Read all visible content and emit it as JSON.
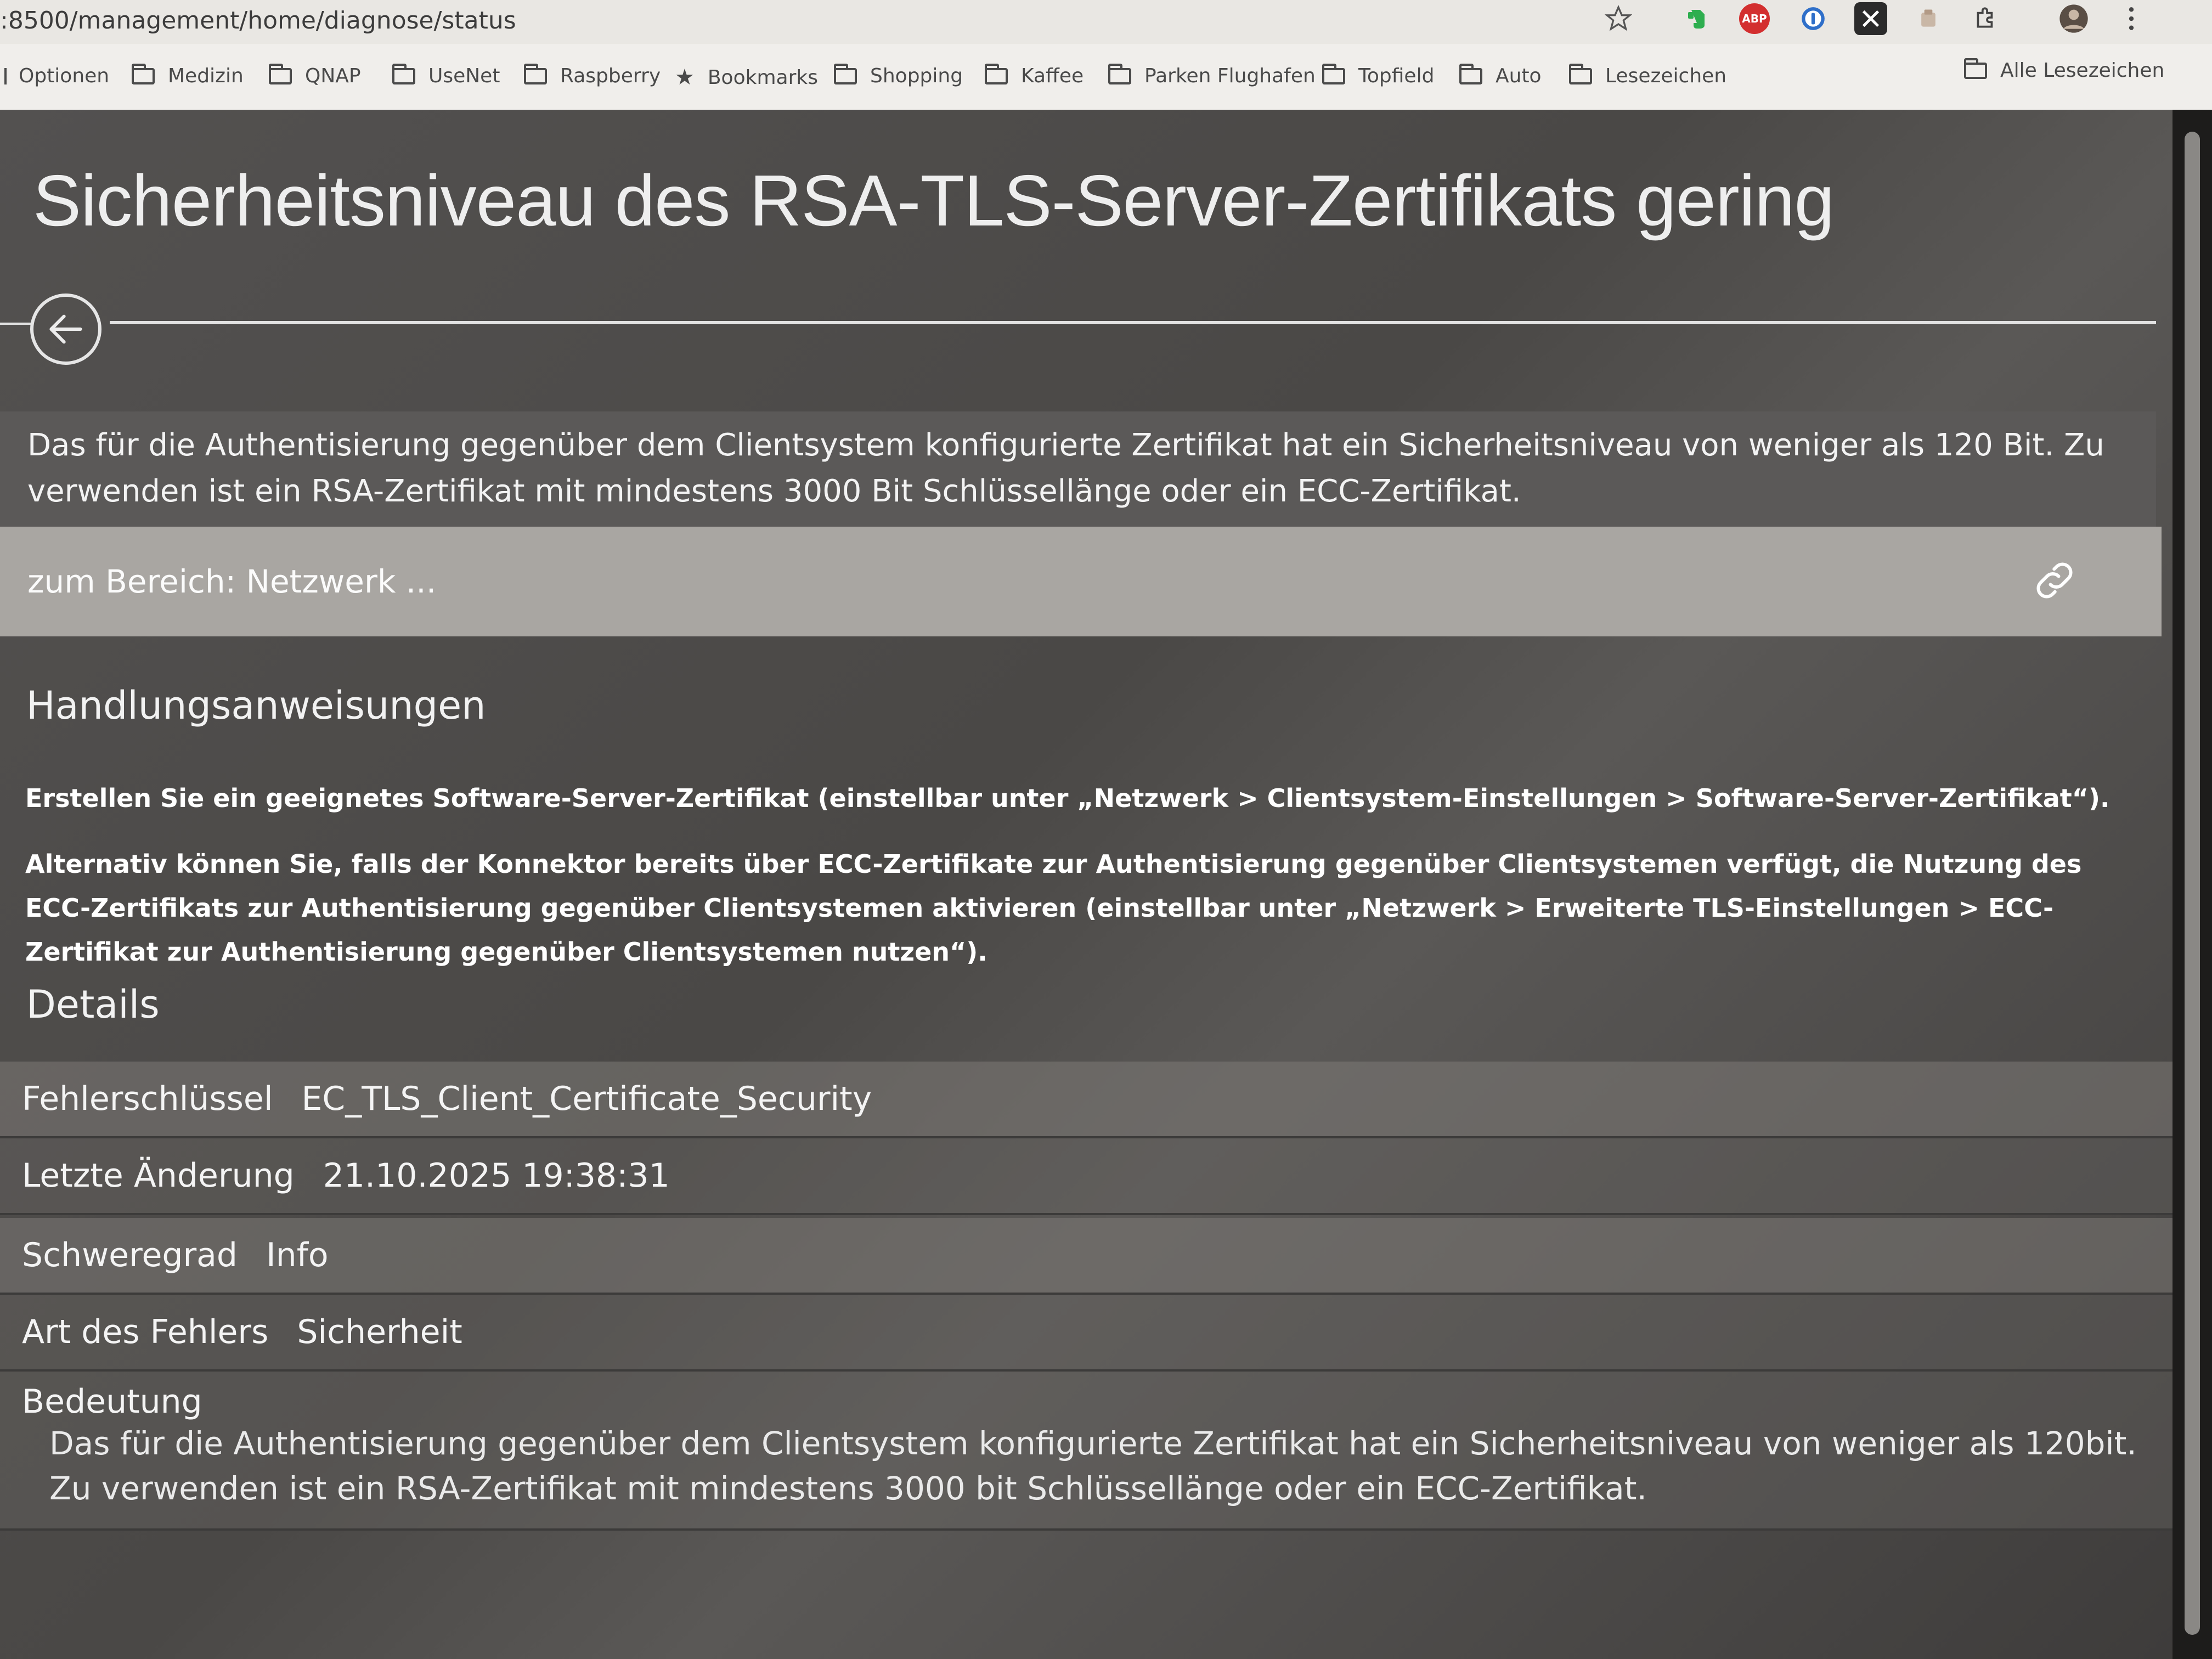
{
  "browser": {
    "url": ":8500/management/home/diagnose/status",
    "bookmarks": [
      {
        "label": "Optionen",
        "icon": "folder-icon"
      },
      {
        "label": "Medizin",
        "icon": "folder-icon"
      },
      {
        "label": "QNAP",
        "icon": "folder-icon"
      },
      {
        "label": "UseNet",
        "icon": "folder-icon"
      },
      {
        "label": "Raspberry",
        "icon": "folder-icon"
      },
      {
        "label": "Bookmarks",
        "icon": "star-icon"
      },
      {
        "label": "Shopping",
        "icon": "folder-icon"
      },
      {
        "label": "Kaffee",
        "icon": "folder-icon"
      },
      {
        "label": "Parken Flughafen",
        "icon": "folder-icon"
      },
      {
        "label": "Topfield",
        "icon": "folder-icon"
      },
      {
        "label": "Auto",
        "icon": "folder-icon"
      },
      {
        "label": "Lesezeichen",
        "icon": "folder-icon"
      }
    ],
    "all_bookmarks_label": "Alle Lesezeichen",
    "extension_icons": [
      "bookmark-star-icon",
      "evernote-icon",
      "adblock-icon",
      "onepassword-icon",
      "x-extension-icon",
      "extension-icon",
      "puzzle-icon",
      "profile-avatar-icon",
      "menu-dots-icon"
    ],
    "extension_text": {
      "adblock": "ABP"
    }
  },
  "page": {
    "title": "Sicherheitsniveau des RSA-TLS-Server-Zertifikats gering",
    "summary": "Das für die Authentisierung gegenüber dem Clientsystem konfigurierte Zertifikat hat ein Sicherheitsniveau von weniger als 120 Bit. Zu verwenden ist ein RSA-Zertifikat mit mindestens 3000 Bit Schlüssellänge oder ein ECC-Zertifikat.",
    "area_link": "zum Bereich: Netzwerk ...",
    "instructions_heading": "Handlungsanweisungen",
    "instruction_1": "Erstellen Sie ein geeignetes Software-Server-Zertifikat (einstellbar unter „Netzwerk > Clientsystem-Einstellungen > Software-Server-Zertifikat“).",
    "instruction_2": "Alternativ können Sie, falls der Konnektor bereits über ECC-Zertifikate zur Authentisierung gegenüber Clientsystemen verfügt, die Nutzung des ECC-Zertifikats zur Authentisierung gegenüber Clientsystemen aktivieren (einstellbar unter „Netzwerk > Erweiterte TLS-Einstellungen > ECC-Zertifikat zur Authentisierung gegenüber Clientsystemen nutzen“).",
    "details_heading": "Details",
    "details": {
      "error_key": {
        "label": "Fehlerschlüssel",
        "value": "EC_TLS_Client_Certificate_Security"
      },
      "last_change": {
        "label": "Letzte Änderung",
        "value": "21.10.2025 19:38:31"
      },
      "severity": {
        "label": "Schweregrad",
        "value": "Info"
      },
      "error_type": {
        "label": "Art des Fehlers",
        "value": "Sicherheit"
      },
      "meaning": {
        "label": "Bedeutung",
        "value": "Das für die Authentisierung gegenüber dem Clientsystem konfigurierte Zertifikat hat ein Sicherheitsniveau von weniger als 120bit. Zu verwenden ist ein RSA-Zertifikat mit mindestens 3000 bit Schlüssellänge oder ein ECC-Zertifikat."
      }
    }
  },
  "colors": {
    "browser_bar": "#e9e7e3",
    "bookmarks_bar": "#f0eeeb",
    "page_background": "#4f4d4b",
    "summary_band": "#5b5958",
    "area_band": "#a9a6a2",
    "text": "#f3f3f3"
  }
}
